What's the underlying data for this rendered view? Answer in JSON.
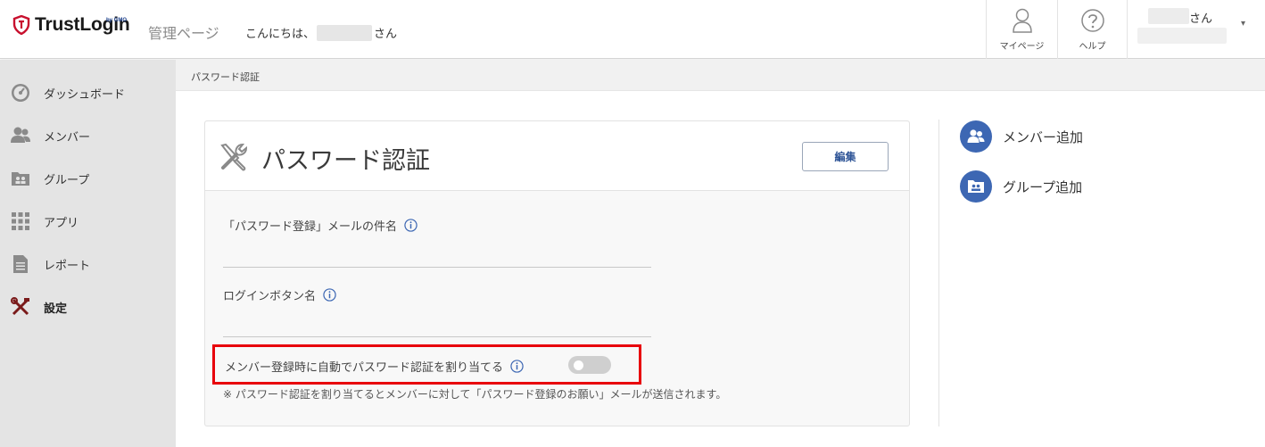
{
  "header": {
    "logo_text": "TrustLogin",
    "logo_sub": "by GMO",
    "admin_label": "管理ページ",
    "greeting_prefix": "こんにちは、",
    "greeting_suffix": "さん",
    "mypage_label": "マイページ",
    "help_label": "ヘルプ",
    "user_suffix": "さん",
    "user_caret": "▾"
  },
  "sidebar": {
    "items": [
      {
        "label": "ダッシュボード",
        "icon": "dashboard-icon"
      },
      {
        "label": "メンバー",
        "icon": "members-icon"
      },
      {
        "label": "グループ",
        "icon": "group-icon"
      },
      {
        "label": "アプリ",
        "icon": "apps-grid-icon"
      },
      {
        "label": "レポート",
        "icon": "report-icon"
      },
      {
        "label": "設定",
        "icon": "settings-tools-icon",
        "active": true
      }
    ]
  },
  "breadcrumb": "パスワード認証",
  "card": {
    "title": "パスワード認証",
    "edit_label": "編集",
    "fields": [
      {
        "label": "「パスワード登録」メールの件名",
        "value": ""
      },
      {
        "label": "ログインボタン名",
        "value": ""
      }
    ],
    "toggle": {
      "label": "メンバー登録時に自動でパスワード認証を割り当てる",
      "on": false
    },
    "note": "※ パスワード認証を割り当てるとメンバーに対して「パスワード登録のお願い」メールが送信されます。"
  },
  "quick_actions": [
    {
      "label": "メンバー追加",
      "icon": "add-member-icon"
    },
    {
      "label": "グループ追加",
      "icon": "add-group-icon"
    }
  ],
  "colors": {
    "accent": "#3d67b3",
    "highlight_border": "#e8000b",
    "logo_red": "#c8102e"
  }
}
